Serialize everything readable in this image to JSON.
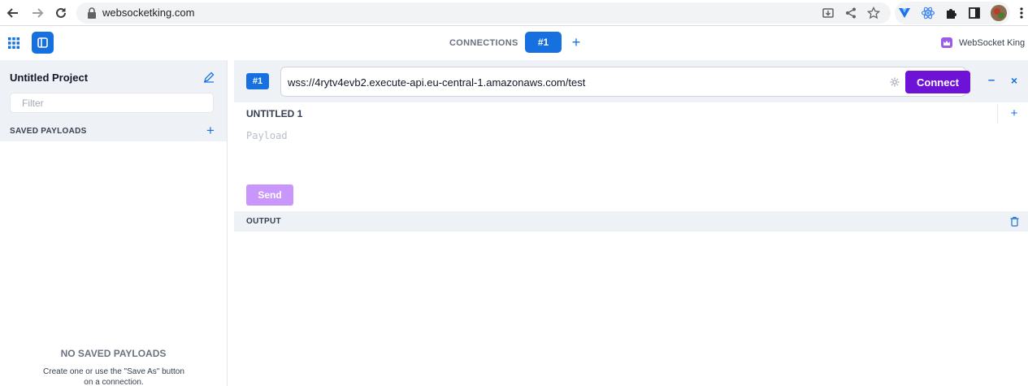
{
  "browser": {
    "url": "websocketking.com"
  },
  "header": {
    "connections_label": "CONNECTIONS",
    "active_tab": "#1",
    "add_label": "+",
    "brand_name": "WebSocket King"
  },
  "sidebar": {
    "project_title": "Untitled Project",
    "filter_placeholder": "Filter",
    "saved_payloads_header": "SAVED PAYLOADS",
    "add_label": "+",
    "empty_title": "NO SAVED PAYLOADS",
    "empty_hint": "Create one or use the \"Save As\" button on a connection."
  },
  "connection": {
    "badge": "#1",
    "url": "wss://4rytv4evb2.execute-api.eu-central-1.amazonaws.com/test",
    "connect_label": "Connect",
    "minimize_label": "–",
    "close_label": "×",
    "payload_tab": "UNTITLED 1",
    "add_payload_label": "+",
    "payload_placeholder": "Payload",
    "send_label": "Send",
    "output_label": "OUTPUT"
  },
  "icons": {
    "back": "arrow-left-icon",
    "forward": "arrow-right-icon",
    "reload": "reload-icon",
    "lock": "lock-icon",
    "apps": "grid-icon",
    "sidebar_toggle": "sidebar-icon",
    "edit": "pencil-icon",
    "settings": "gear-icon",
    "trash": "trash-icon"
  },
  "colors": {
    "accent": "#1670e0",
    "connect": "#6d12d6",
    "send": "#c084fc",
    "panel_bg": "#eef2f7"
  }
}
